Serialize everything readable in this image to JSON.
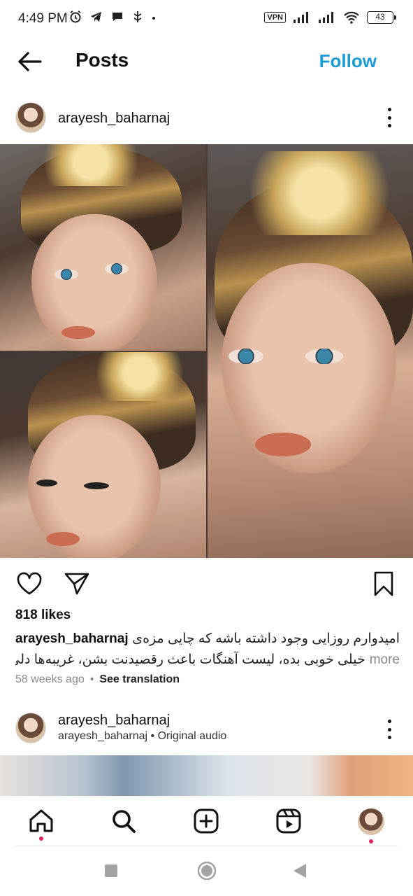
{
  "status_bar": {
    "time": "4:49 PM",
    "vpn": "VPN",
    "battery": "43"
  },
  "header": {
    "title": "Posts",
    "follow_label": "Follow"
  },
  "post1": {
    "username": "arayesh_baharnaj",
    "likes": "818 likes",
    "caption_user": "arayesh_baharnaj",
    "caption_line1": "امیدوارم روزایی وجود داشته باشه که چایی مزه‌ی",
    "caption_line2": "خیلی خوبی بده، لیست آهنگات باعث رقصیدنت بشن، غریبه‌ها دلی...",
    "more_label": "more",
    "time_ago": "58 weeks ago",
    "separator": "•",
    "see_translation": "See translation"
  },
  "post2": {
    "username": "arayesh_baharnaj",
    "audio_label": "arayesh_baharnaj • Original audio"
  },
  "icons": {
    "back": "arrow-left",
    "more": "three-dots-vertical",
    "like": "heart-outline",
    "share": "paper-plane",
    "save": "bookmark-outline",
    "home": "home",
    "search": "search",
    "create": "plus-square",
    "reels": "reels",
    "profile": "avatar"
  },
  "colors": {
    "follow": "#1a9bd6",
    "notification_dot": "#e0245e"
  }
}
